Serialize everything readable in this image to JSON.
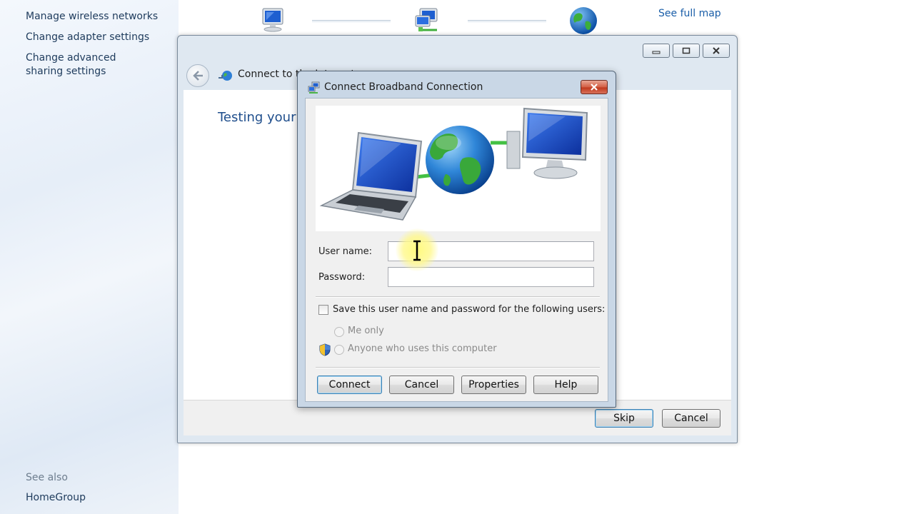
{
  "left_pane": {
    "links": [
      "Manage wireless networks",
      "Change adapter settings",
      "Change advanced sharing settings"
    ],
    "see_also_label": "See also",
    "homegroup_label": "HomeGroup"
  },
  "network_map": {
    "see_full_map": "See full map"
  },
  "wizard": {
    "title": "Connect to the Internet",
    "heading": "Testing your Internet connection",
    "skip_label": "Skip",
    "cancel_label": "Cancel"
  },
  "dialog": {
    "title": "Connect Broadband Connection",
    "username_label": "User name:",
    "username_value": "",
    "password_label": "Password:",
    "password_value": "",
    "save_label": "Save this user name and password for the following users:",
    "me_only_label": "Me only",
    "anyone_label": "Anyone who uses this computer",
    "buttons": {
      "connect": "Connect",
      "cancel": "Cancel",
      "properties": "Properties",
      "help": "Help"
    }
  },
  "colors": {
    "link": "#1e3b5c",
    "heading": "#1f4e8c",
    "dialog_frame": "#c9d7e6"
  }
}
